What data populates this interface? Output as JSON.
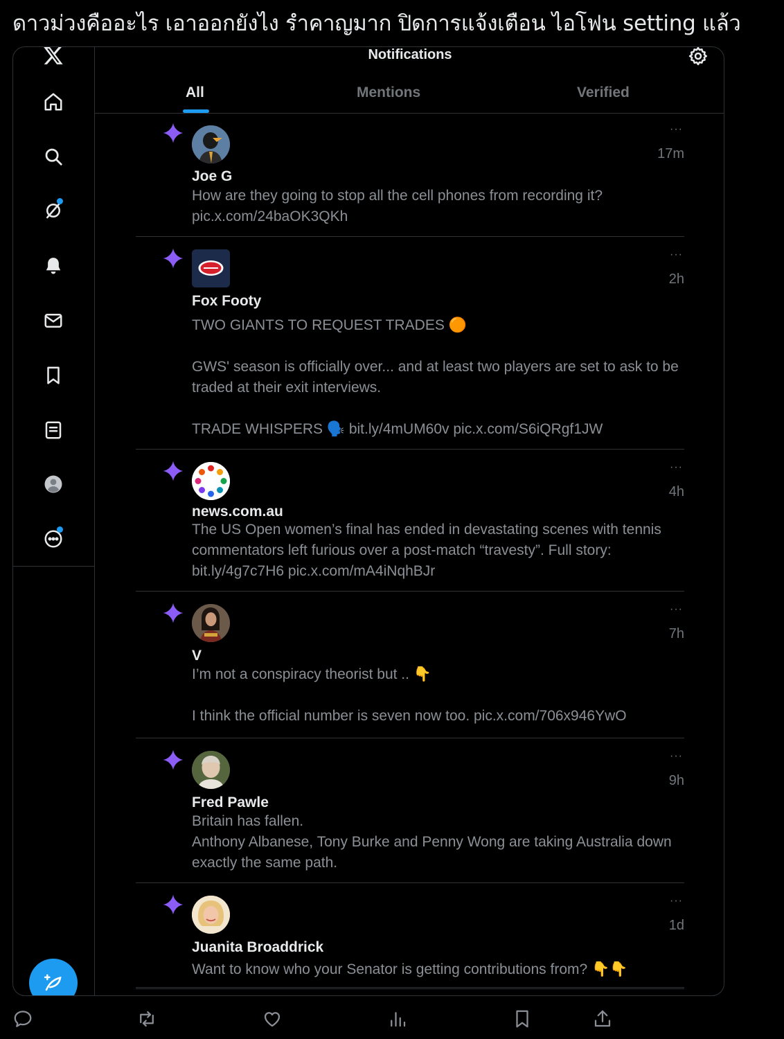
{
  "post": {
    "text": "ดาวม่วงคืออะไร เอาออกยังไง รำคาญมาก ปิดการแจ้งเตือน ไอโฟน setting แล้ว"
  },
  "header": {
    "title": "Notifications",
    "tabs": [
      {
        "label": "All",
        "active": true
      },
      {
        "label": "Mentions",
        "active": false
      },
      {
        "label": "Verified",
        "active": false
      }
    ]
  },
  "sidebar": {
    "items": [
      "x-logo-icon",
      "home-icon",
      "search-icon",
      "grok-icon",
      "notifications-icon",
      "messages-icon",
      "bookmarks-icon",
      "lists-icon",
      "profile-icon",
      "more-icon"
    ]
  },
  "notifications": [
    {
      "name": "Joe G",
      "time": "17m",
      "text": "How are they going to stop all the cell phones from recording it?\npic.x.com/24baOK3QKh"
    },
    {
      "name": "Fox Footy",
      "time": "2h",
      "text": "TWO GIANTS TO REQUEST TRADES 🟠\n\nGWS' season is officially over... and at least two players are set to ask to be traded at their exit interviews.\n\nTRADE WHISPERS 🗣️ bit.ly/4mUM60v pic.x.com/S6iQRgf1JW"
    },
    {
      "name": "news.com.au",
      "time": "4h",
      "text": "The US Open women’s final has ended in devastating scenes with tennis commentators left furious over a post-match “travesty”. Full story: bit.ly/4g7c7H6 pic.x.com/mA4iNqhBJr"
    },
    {
      "name": "V",
      "time": "7h",
      "text": "I’m not a conspiracy theorist but .. 👇\n\nI think the official number is seven now too. pic.x.com/706x946YwO"
    },
    {
      "name": "Fred Pawle",
      "time": "9h",
      "text": "Britain has fallen.\nAnthony Albanese, Tony Burke and Penny Wong are taking Australia down exactly the same path."
    },
    {
      "name": "Juanita Broaddrick",
      "time": "1d",
      "text": "Want to know who your Senator is getting contributions from?       👇👇"
    }
  ],
  "more_label": "···",
  "colors": {
    "accent": "#1d9bf0",
    "sparkle": "#8b5cf6",
    "muted": "#71767b"
  }
}
